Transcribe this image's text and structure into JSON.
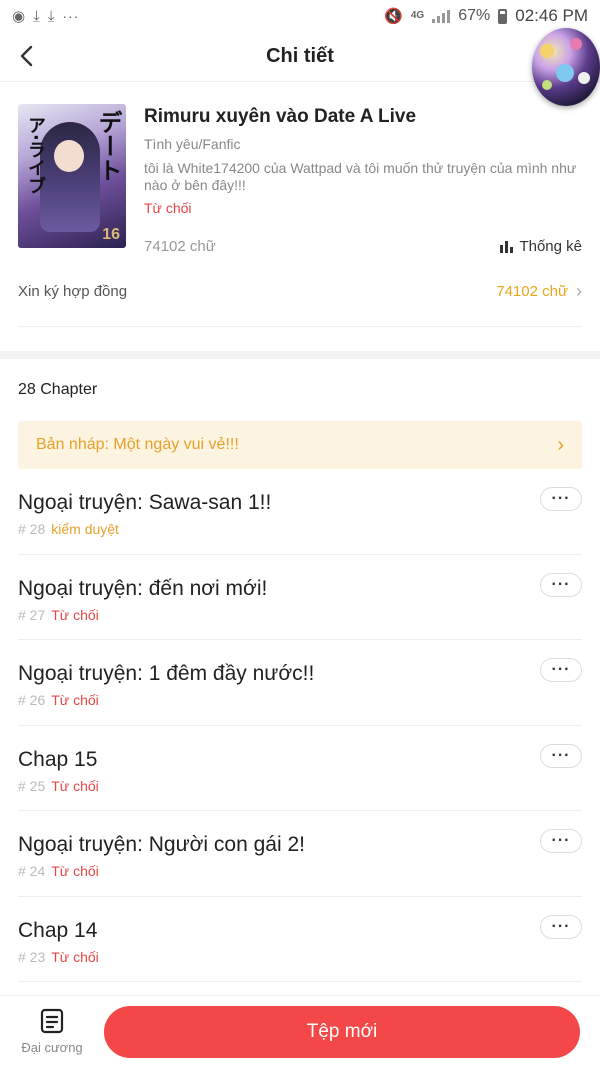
{
  "status_bar": {
    "battery": "67%",
    "time": "02:46 PM",
    "network": "4G",
    "more": "···"
  },
  "header": {
    "title": "Chi tiết"
  },
  "story": {
    "title": "Rimuru xuyên vào Date A Live",
    "genre": "Tình yêu/Fanfic",
    "description": "tôi là White174200 của Wattpad và tôi muốn thử truyện của mình như nào ở bên đây!!!",
    "status": "Từ chối",
    "word_count": "74102 chữ",
    "stats_label": "Thống kê"
  },
  "contract": {
    "label": "Xin ký hợp đồng",
    "value": "74102 chữ"
  },
  "chapter_count": "28 Chapter",
  "draft": {
    "text": "Bản nháp: Một ngày vui vẻ!!!"
  },
  "chapters": [
    {
      "title": "Ngoại truyện: Sawa-san 1!!",
      "number": "# 28",
      "status": "kiểm duyệt",
      "status_type": "review"
    },
    {
      "title": "Ngoại truyện: đến nơi mới!",
      "number": "# 27",
      "status": "Từ chối",
      "status_type": "rejected"
    },
    {
      "title": "Ngoại truyện: 1 đêm đầy nước!!",
      "number": "# 26",
      "status": "Từ chối",
      "status_type": "rejected"
    },
    {
      "title": "Chap 15",
      "number": "# 25",
      "status": "Từ chối",
      "status_type": "rejected"
    },
    {
      "title": "Ngoại truyện: Người con gái 2!",
      "number": "# 24",
      "status": "Từ chối",
      "status_type": "rejected"
    },
    {
      "title": "Chap 14",
      "number": "# 23",
      "status": "Từ chối",
      "status_type": "rejected"
    }
  ],
  "bottom": {
    "outline_label": "Đại cương",
    "new_file_label": "Tệp mới"
  },
  "colors": {
    "accent_red": "#f44747",
    "status_red": "#e84545",
    "status_yellow": "#e6a12a",
    "draft_bg": "#fdf3e1"
  }
}
